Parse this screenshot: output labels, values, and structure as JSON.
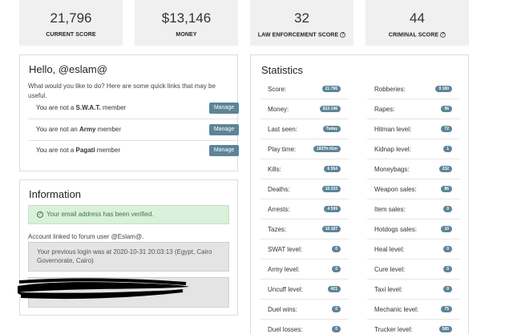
{
  "top_stats": [
    {
      "value": "21,796",
      "label": "CURRENT SCORE",
      "help": false
    },
    {
      "value": "$13,146",
      "label": "MONEY",
      "help": false
    },
    {
      "value": "32",
      "label": "LAW ENFORCEMENT SCORE",
      "help": true
    },
    {
      "value": "44",
      "label": "CRIMINAL SCORE",
      "help": true
    }
  ],
  "hello": {
    "title": "Hello, @eslam@",
    "intro": "What would you like to do? Here are some quick links that may be useful.",
    "rows": [
      {
        "prefix": "You are not a ",
        "group": "S.W.A.T.",
        "suffix": " member",
        "button": "Manage"
      },
      {
        "prefix": "You are not an ",
        "group": "Army",
        "suffix": " member",
        "button": "Manage"
      },
      {
        "prefix": "You are not a ",
        "group": "Pagati",
        "suffix": " member",
        "button": "Manage"
      }
    ]
  },
  "information": {
    "title": "Information",
    "verified": "Your email address has been verified.",
    "forum": "Account linked to forum user @Eslam@.",
    "last_login": "Your previous login was at 2020-10-31 20:03:13 (Egypt, Cairo Governorate, Cairo)"
  },
  "statistics": {
    "title": "Statistics",
    "left": [
      {
        "label": "Score:",
        "value": "21 796"
      },
      {
        "label": "Money:",
        "value": "$13 146"
      },
      {
        "label": "Last seen:",
        "value": "Today"
      },
      {
        "label": "Play time:",
        "value": "1837h:41m"
      },
      {
        "label": "Kills:",
        "value": "6 554"
      },
      {
        "label": "Deaths:",
        "value": "10 233"
      },
      {
        "label": "Arrests:",
        "value": "4 599"
      },
      {
        "label": "Tazes:",
        "value": "10 187"
      },
      {
        "label": "SWAT level:",
        "value": "0"
      },
      {
        "label": "Army level:",
        "value": "0"
      },
      {
        "label": "Uncuff level:",
        "value": "421"
      },
      {
        "label": "Duel wins:",
        "value": "0"
      },
      {
        "label": "Duel losses:",
        "value": "0"
      }
    ],
    "right": [
      {
        "label": "Robberies:",
        "value": "9 180"
      },
      {
        "label": "Rapes:",
        "value": "96"
      },
      {
        "label": "Hitman level:",
        "value": "72"
      },
      {
        "label": "Kidnap level:",
        "value": "1"
      },
      {
        "label": "Moneybags:",
        "value": "232"
      },
      {
        "label": "Weapon sales:",
        "value": "86"
      },
      {
        "label": "Item sales:",
        "value": "0"
      },
      {
        "label": "Hotdogs sales:",
        "value": "10"
      },
      {
        "label": "Heal level:",
        "value": "0"
      },
      {
        "label": "Cure level:",
        "value": "0"
      },
      {
        "label": "Taxi level:",
        "value": "0"
      },
      {
        "label": "Mechanic level:",
        "value": "75"
      },
      {
        "label": "Trucker level:",
        "value": "585"
      }
    ]
  },
  "colors": {
    "accent": "#5d8597",
    "success_bg": "#d9f0da"
  }
}
